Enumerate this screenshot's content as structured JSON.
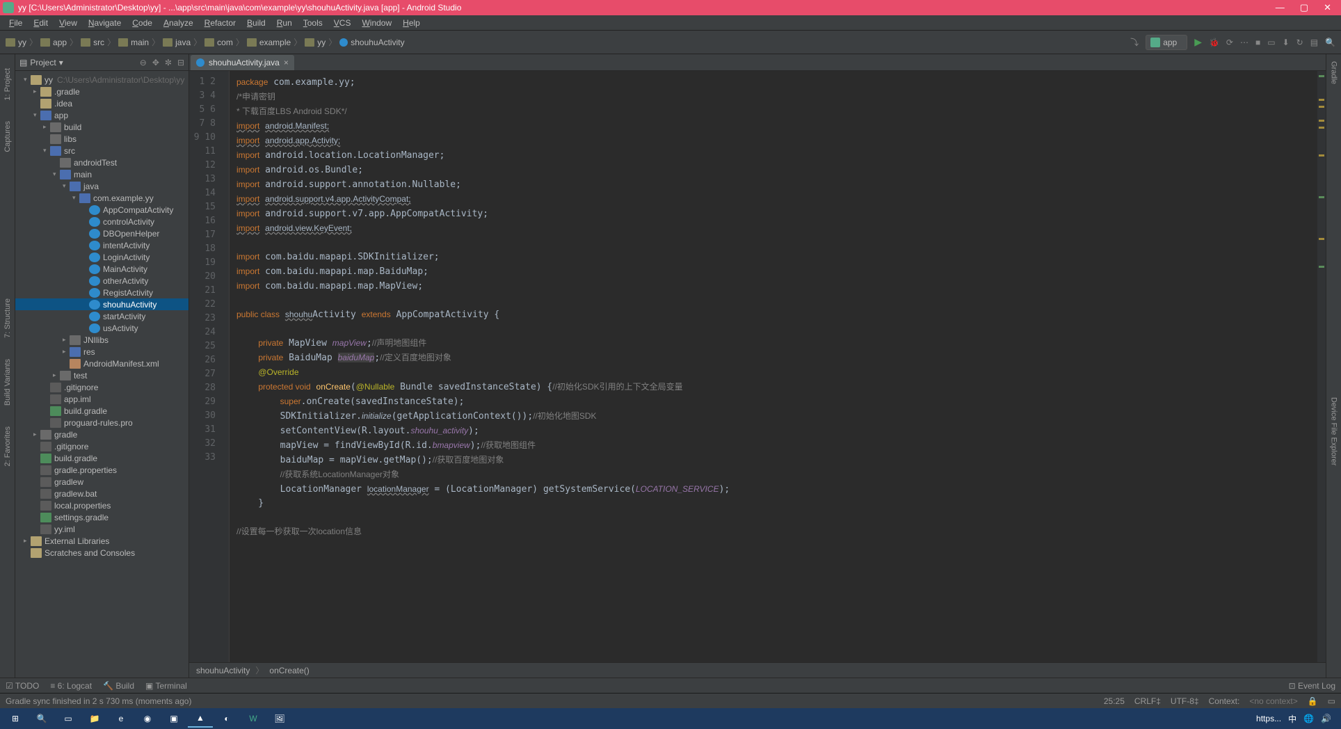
{
  "title": "yy [C:\\Users\\Administrator\\Desktop\\yy] - ...\\app\\src\\main\\java\\com\\example\\yy\\shouhuActivity.java [app] - Android Studio",
  "menu": [
    "File",
    "Edit",
    "View",
    "Navigate",
    "Code",
    "Analyze",
    "Refactor",
    "Build",
    "Run",
    "Tools",
    "VCS",
    "Window",
    "Help"
  ],
  "crumbs": [
    "yy",
    "app",
    "src",
    "main",
    "java",
    "com",
    "example",
    "yy",
    "shouhuActivity"
  ],
  "runconfig": "app",
  "projectLabel": "Project",
  "tree": [
    {
      "d": 0,
      "a": "▾",
      "ic": "fold-y",
      "t": "yy",
      "extra": "C:\\Users\\Administrator\\Desktop\\yy"
    },
    {
      "d": 1,
      "a": "▸",
      "ic": "fold-y",
      "t": ".gradle"
    },
    {
      "d": 1,
      "a": "",
      "ic": "fold-y",
      "t": ".idea"
    },
    {
      "d": 1,
      "a": "▾",
      "ic": "fold-b",
      "t": "app"
    },
    {
      "d": 2,
      "a": "▸",
      "ic": "fold-g",
      "t": "build"
    },
    {
      "d": 2,
      "a": "",
      "ic": "fold-g",
      "t": "libs"
    },
    {
      "d": 2,
      "a": "▾",
      "ic": "fold-b",
      "t": "src"
    },
    {
      "d": 3,
      "a": "",
      "ic": "fold-g",
      "t": "androidTest"
    },
    {
      "d": 3,
      "a": "▾",
      "ic": "fold-b",
      "t": "main"
    },
    {
      "d": 4,
      "a": "▾",
      "ic": "fold-b",
      "t": "java"
    },
    {
      "d": 5,
      "a": "▾",
      "ic": "fold-b",
      "t": "com.example.yy"
    },
    {
      "d": 6,
      "a": "",
      "ic": "file-c",
      "t": "AppCompatActivity"
    },
    {
      "d": 6,
      "a": "",
      "ic": "file-c",
      "t": "controlActivity"
    },
    {
      "d": 6,
      "a": "",
      "ic": "file-c",
      "t": "DBOpenHelper"
    },
    {
      "d": 6,
      "a": "",
      "ic": "file-c",
      "t": "intentActivity"
    },
    {
      "d": 6,
      "a": "",
      "ic": "file-c",
      "t": "LoginActivity"
    },
    {
      "d": 6,
      "a": "",
      "ic": "file-c",
      "t": "MainActivity"
    },
    {
      "d": 6,
      "a": "",
      "ic": "file-c",
      "t": "otherActivity"
    },
    {
      "d": 6,
      "a": "",
      "ic": "file-c",
      "t": "RegistActivity"
    },
    {
      "d": 6,
      "a": "",
      "ic": "file-c",
      "t": "shouhuActivity",
      "sel": true
    },
    {
      "d": 6,
      "a": "",
      "ic": "file-c",
      "t": "startActivity"
    },
    {
      "d": 6,
      "a": "",
      "ic": "file-c",
      "t": "usActivity"
    },
    {
      "d": 4,
      "a": "▸",
      "ic": "fold-g",
      "t": "JNIlibs"
    },
    {
      "d": 4,
      "a": "▸",
      "ic": "fold-b",
      "t": "res"
    },
    {
      "d": 4,
      "a": "",
      "ic": "file-x",
      "t": "AndroidManifest.xml"
    },
    {
      "d": 3,
      "a": "▸",
      "ic": "fold-g",
      "t": "test"
    },
    {
      "d": 2,
      "a": "",
      "ic": "file-t",
      "t": ".gitignore"
    },
    {
      "d": 2,
      "a": "",
      "ic": "file-t",
      "t": "app.iml"
    },
    {
      "d": 2,
      "a": "",
      "ic": "file-gr",
      "t": "build.gradle"
    },
    {
      "d": 2,
      "a": "",
      "ic": "file-t",
      "t": "proguard-rules.pro"
    },
    {
      "d": 1,
      "a": "▸",
      "ic": "fold-g",
      "t": "gradle"
    },
    {
      "d": 1,
      "a": "",
      "ic": "file-t",
      "t": ".gitignore"
    },
    {
      "d": 1,
      "a": "",
      "ic": "file-gr",
      "t": "build.gradle"
    },
    {
      "d": 1,
      "a": "",
      "ic": "file-t",
      "t": "gradle.properties"
    },
    {
      "d": 1,
      "a": "",
      "ic": "file-t",
      "t": "gradlew"
    },
    {
      "d": 1,
      "a": "",
      "ic": "file-t",
      "t": "gradlew.bat"
    },
    {
      "d": 1,
      "a": "",
      "ic": "file-t",
      "t": "local.properties"
    },
    {
      "d": 1,
      "a": "",
      "ic": "file-gr",
      "t": "settings.gradle"
    },
    {
      "d": 1,
      "a": "",
      "ic": "file-t",
      "t": "yy.iml"
    },
    {
      "d": 0,
      "a": "▸",
      "ic": "fold-y",
      "t": "External Libraries"
    },
    {
      "d": 0,
      "a": "",
      "ic": "fold-y",
      "t": "Scratches and Consoles"
    }
  ],
  "tab": "shouhuActivity.java",
  "code": [
    "<span class='kw'>package</span> com.example.yy;",
    "<span class='cmt'>/*申请密钥</span>",
    "<span class='cmt'>* 下载百度LBS Android SDK*/</span>",
    "<span class='kw under'>import</span> <span class='under'>android.Manifest;</span>",
    "<span class='kw under'>import</span> <span class='under'>android.app.Activity;</span>",
    "<span class='kw'>import</span> android.location.LocationManager;",
    "<span class='kw'>import</span> android.os.Bundle;",
    "<span class='kw'>import</span> android.support.annotation.Nullable;",
    "<span class='kw under'>import</span> <span class='under'>android.support.v4.app.ActivityCompat;</span>",
    "<span class='kw'>import</span> android.support.v7.app.AppCompatActivity;",
    "<span class='kw under'>import</span> <span class='under'>android.view.KeyEvent;</span>",
    "",
    "<span class='kw'>import</span> com.baidu.mapapi.SDKInitializer;",
    "<span class='kw'>import</span> com.baidu.mapapi.map.BaiduMap;",
    "<span class='kw'>import</span> com.baidu.mapapi.map.MapView;",
    "",
    "<span class='kw'>public class</span> <span class='under'>shouhu</span>Activity <span class='kw'>extends</span> AppCompatActivity {",
    "",
    "    <span class='kw'>private</span> MapView <span class='it'>mapView</span>;<span class='cmt'>//声明地图组件</span>",
    "    <span class='kw'>private</span> BaiduMap <span class='it boxed'>baiduMap</span>;<span class='cmt'>//定义百度地图对象</span>",
    "    <span class='ann'>@Override</span>",
    "    <span class='kw'>protected void</span> <span style='color:#ffc66d'>onCreate</span>(<span class='ann'>@Nullable</span> Bundle savedInstanceState) {<span class='cmt'>//初始化SDK引用的上下文全局变量</span>",
    "        <span class='kw'>super</span>.onCreate(savedInstanceState);",
    "        SDKInitializer.<span style='font-style:italic'>initialize</span>(getApplicationContext());<span class='cmt'>//初始化地图SDK</span>",
    "        setContentView(R.layout.<span class='it'>shouhu_activity</span>);",
    "        mapView = findViewById(R.id.<span class='it'>bmapview</span>);<span class='cmt'>//获取地图组件</span>",
    "        baiduMap = mapView.getMap();<span class='cmt'>//获取百度地图对象</span>",
    "        <span class='cmt'>//获取系统LocationManager对象</span>",
    "        LocationManager <span class='under'>locationManager</span> = (LocationManager) getSystemService(<span class='it' style='color:#9876aa'>LOCATION_SERVICE</span>);",
    "    }",
    "",
    "<span class='cmt'>//设置每一秒获取一次location信息</span>",
    ""
  ],
  "bread2": [
    "shouhuActivity",
    "onCreate()"
  ],
  "bottom": {
    "todo": "TODO",
    "logcat": "6: Logcat",
    "build": "Build",
    "terminal": "Terminal",
    "eventlog": "Event Log"
  },
  "status": {
    "msg": "Gradle sync finished in 2 s 730 ms (moments ago)",
    "pos": "25:25",
    "crlf": "CRLF",
    "enc": "UTF-8",
    "ctx": "Context:"
  },
  "leftlabels": [
    "1: Project",
    "7: Structure",
    "Captures",
    "Build Variants",
    "2: Favorites"
  ],
  "rightlabels": [
    "Gradle",
    "Device File Explorer"
  ],
  "tray": {
    "url": "https..."
  }
}
